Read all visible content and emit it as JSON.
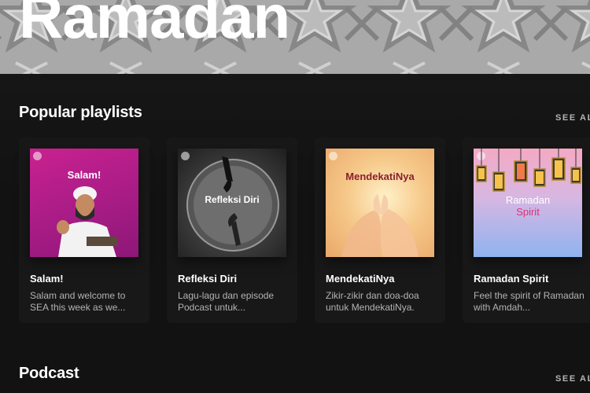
{
  "hero": {
    "title": "Ramadan"
  },
  "sections": [
    {
      "title": "Popular playlists",
      "see_all": "SEE ALL"
    },
    {
      "title": "Podcast",
      "see_all": "SEE ALL"
    }
  ],
  "playlists": [
    {
      "cover_title": "Salam!",
      "title": "Salam!",
      "description": "Salam and welcome to SEA this week as we..."
    },
    {
      "cover_title": "Refleksi Diri",
      "title": "Refleksi Diri",
      "description": "Lagu-lagu dan episode Podcast untuk..."
    },
    {
      "cover_title": "MendekatiNya",
      "title": "MendekatiNya",
      "description": "Zikir-zikir dan doa-doa untuk MendekatiNya."
    },
    {
      "cover_title_line1": "Ramadan",
      "cover_title_line2": "Spirit",
      "title": "Ramadan Spirit",
      "description": "Feel the spirit of Ramadan with Amdah..."
    }
  ],
  "colors": {
    "background": "#121212",
    "card": "#181818",
    "muted_text": "#b3b3b3"
  }
}
